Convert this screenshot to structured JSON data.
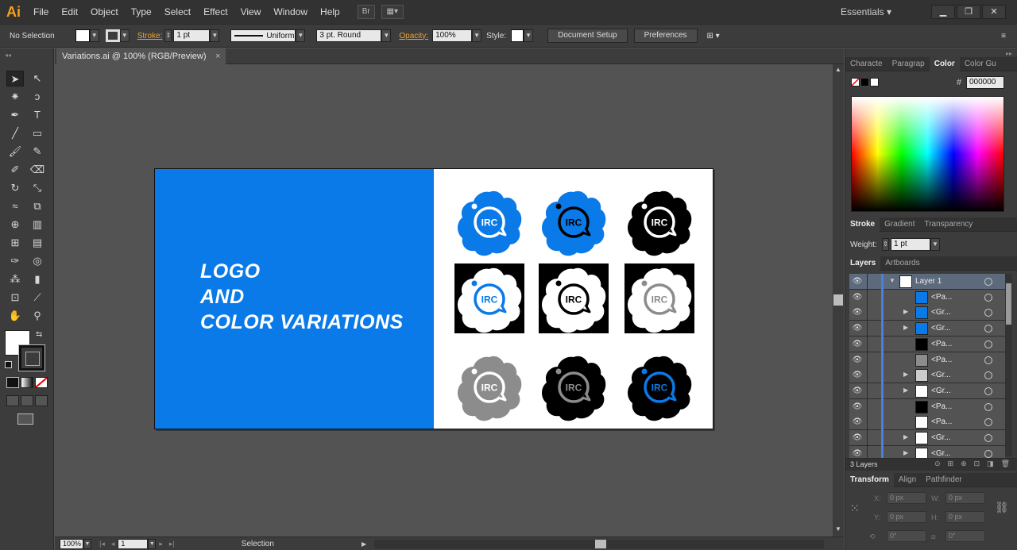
{
  "app": {
    "logo": "Ai",
    "workspace": "Essentials ▾",
    "brand_color": "#f7a21b"
  },
  "menu": [
    "File",
    "Edit",
    "Object",
    "Type",
    "Select",
    "Effect",
    "View",
    "Window",
    "Help"
  ],
  "control": {
    "selection": "No Selection",
    "stroke_label": "Stroke:",
    "stroke_weight": "1 pt",
    "profile": "Uniform",
    "brush": "3 pt. Round",
    "opacity_label": "Opacity:",
    "opacity": "100%",
    "style_label": "Style:",
    "doc_setup": "Document Setup",
    "preferences": "Preferences"
  },
  "document": {
    "tab": "Variations.ai @ 100% (RGB/Preview)",
    "close": "×"
  },
  "artboard": {
    "title_lines": [
      "LOGO",
      "AND",
      "COLOR VARIATIONS"
    ],
    "panel_color": "#0a7ae8",
    "logo_text": "IRC",
    "logos": [
      {
        "shape": "cloud",
        "bg": "none",
        "fill": "#0a7ae8",
        "ring": "#ffffff",
        "text": "#ffffff",
        "dot": "#ffffff",
        "inner": "none"
      },
      {
        "shape": "cloud",
        "bg": "none",
        "fill": "#0a7ae8",
        "ring": "#000000",
        "text": "#000000",
        "dot": "#000000",
        "inner": "none"
      },
      {
        "shape": "cloud",
        "bg": "none",
        "fill": "#000000",
        "ring": "#ffffff",
        "text": "#ffffff",
        "dot": "#ffffff",
        "inner": "none"
      },
      {
        "shape": "cloud",
        "bg": "#000000",
        "fill": "#ffffff",
        "ring": "#0a7ae8",
        "text": "#0a7ae8",
        "dot": "#0a7ae8",
        "inner": "none"
      },
      {
        "shape": "cloud",
        "bg": "#000000",
        "fill": "#ffffff",
        "ring": "#000000",
        "text": "#000000",
        "dot": "#000000",
        "inner": "none"
      },
      {
        "shape": "cloud",
        "bg": "#000000",
        "fill": "#ffffff",
        "ring": "#8c8c8c",
        "text": "#8c8c8c",
        "dot": "#8c8c8c",
        "inner": "none"
      },
      {
        "shape": "cloud",
        "bg": "none",
        "fill": "#8c8c8c",
        "ring": "#ffffff",
        "text": "#ffffff",
        "dot": "#ffffff",
        "inner": "none"
      },
      {
        "shape": "cloud",
        "bg": "none",
        "fill": "#000000",
        "ring": "#8c8c8c",
        "text": "#8c8c8c",
        "dot": "#8c8c8c",
        "inner": "none"
      },
      {
        "shape": "cloud",
        "bg": "none",
        "fill": "#000000",
        "ring": "#0a7ae8",
        "text": "#0a7ae8",
        "dot": "#0a7ae8",
        "inner": "none"
      }
    ]
  },
  "status": {
    "zoom": "100%",
    "page": "1",
    "tool": "Selection"
  },
  "color_panel": {
    "tabs": [
      "Characte",
      "Paragrap",
      "Color",
      "Color Gu"
    ],
    "active": "Color",
    "hash": "#",
    "hex": "000000"
  },
  "stroke_panel": {
    "tabs": [
      "Stroke",
      "Gradient",
      "Transparency"
    ],
    "weight_label": "Weight:",
    "weight": "1 pt"
  },
  "layers_panel": {
    "tabs": [
      "Layers",
      "Artboards"
    ],
    "count": "3 Layers",
    "rows": [
      {
        "name": "Layer 1",
        "level": 0,
        "expand": "▼",
        "thumb": "#ffffff"
      },
      {
        "name": "<Pa...",
        "level": 1,
        "expand": "",
        "thumb": "#0a7ae8"
      },
      {
        "name": "<Gr...",
        "level": 1,
        "expand": "▶",
        "thumb": "#0a7ae8"
      },
      {
        "name": "<Gr...",
        "level": 1,
        "expand": "▶",
        "thumb": "#0a7ae8"
      },
      {
        "name": "<Pa...",
        "level": 1,
        "expand": "",
        "thumb": "#000000"
      },
      {
        "name": "<Pa...",
        "level": 1,
        "expand": "",
        "thumb": "#8c8c8c"
      },
      {
        "name": "<Gr...",
        "level": 1,
        "expand": "▶",
        "thumb": "#cccccc"
      },
      {
        "name": "<Gr...",
        "level": 1,
        "expand": "▶",
        "thumb": "#ffffff"
      },
      {
        "name": "<Pa...",
        "level": 1,
        "expand": "",
        "thumb": "#000000"
      },
      {
        "name": "<Pa...",
        "level": 1,
        "expand": "",
        "thumb": "#ffffff"
      },
      {
        "name": "<Gr...",
        "level": 1,
        "expand": "▶",
        "thumb": "#ffffff"
      },
      {
        "name": "<Gr...",
        "level": 1,
        "expand": "▶",
        "thumb": "#ffffff"
      }
    ]
  },
  "transform_panel": {
    "tabs": [
      "Transform",
      "Align",
      "Pathfinder"
    ],
    "x_label": "X:",
    "x": "0 px",
    "w_label": "W:",
    "w": "0 px",
    "y_label": "Y:",
    "y": "0 px",
    "h_label": "H:",
    "h": "0 px",
    "rot": "0°",
    "shear": "0°"
  }
}
